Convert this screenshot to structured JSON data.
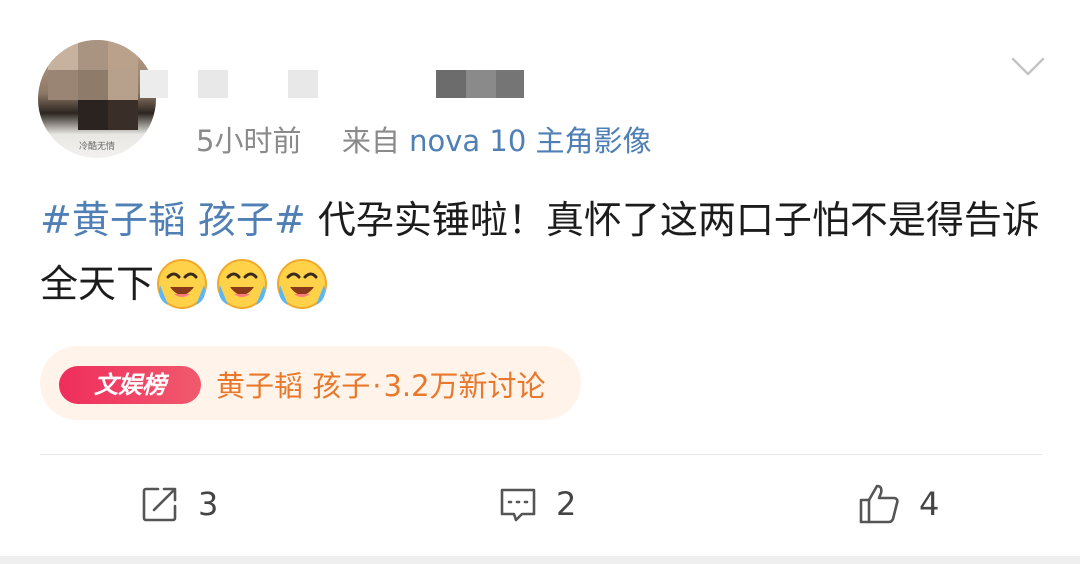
{
  "post": {
    "author": {
      "avatar_caption": "冷酷无情"
    },
    "meta": {
      "time": "5小时前",
      "source_prefix": "来自",
      "device": "nova 10 主角影像"
    },
    "content": {
      "hashtag": "#黄子韬 孩子#",
      "text": " 代孕实锤啦！真怀了这两口子怕不是得告诉全天下"
    },
    "topic": {
      "badge": "文娱榜",
      "title": "黄子韬 孩子",
      "separator": "·",
      "stat": "3.2万新讨论"
    },
    "actions": {
      "repost_count": "3",
      "comment_count": "2",
      "like_count": "4"
    }
  },
  "colors": {
    "link_blue": "#4f7fb5",
    "topic_orange": "#e8782c",
    "badge_red": "#ef2d5c",
    "topic_bg": "#fff3ea"
  },
  "icons": [
    "chevron-down-icon",
    "emoji-laugh-cry-icon",
    "repost-icon",
    "comment-icon",
    "like-icon"
  ]
}
